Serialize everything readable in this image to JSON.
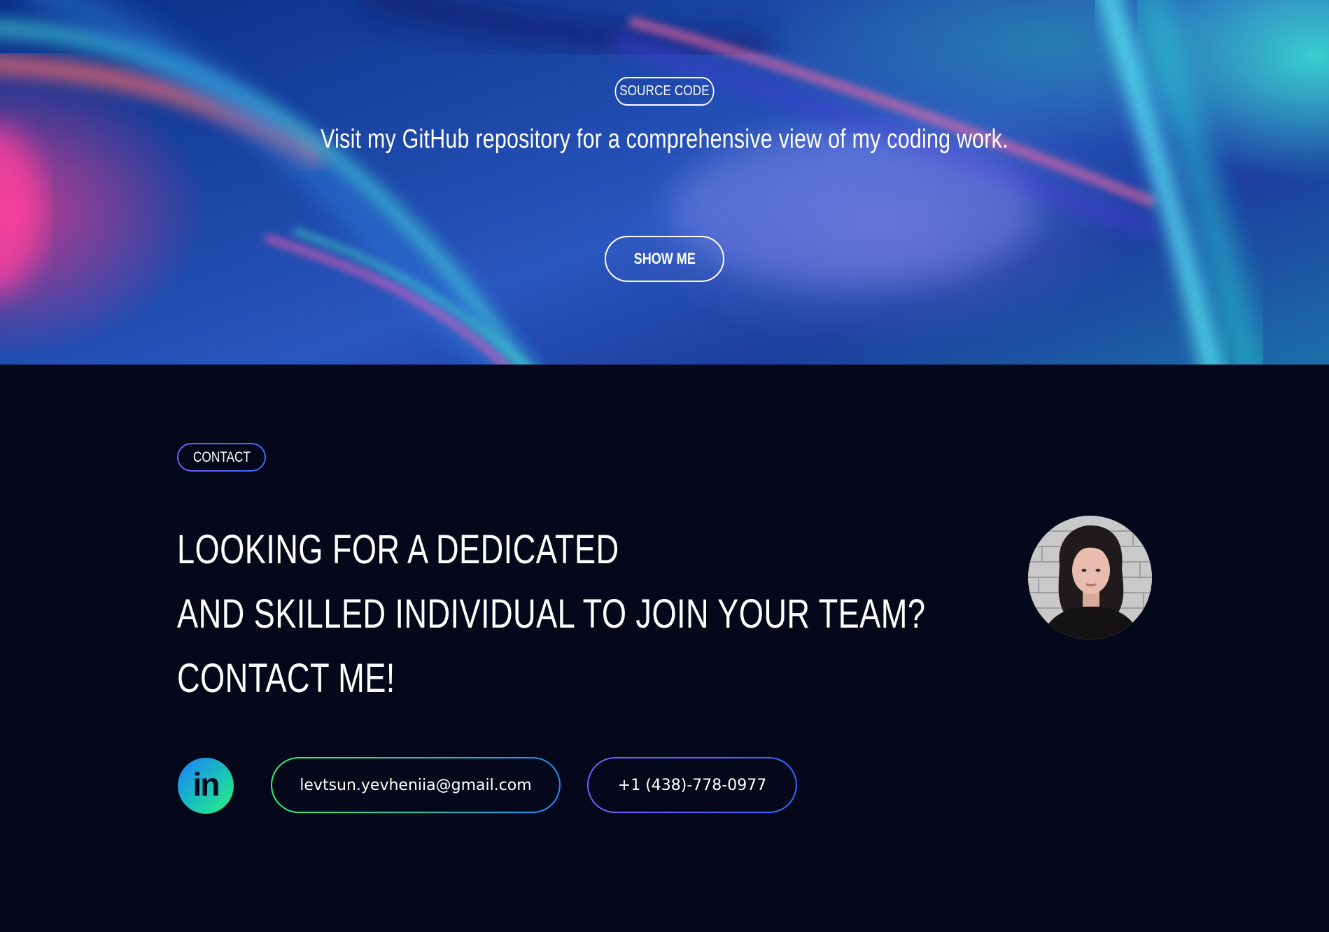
{
  "hero": {
    "badge": "SOURCE CODE",
    "description": "Visit my GitHub repository for a comprehensive view of my coding work.",
    "button_label": "SHOW ME"
  },
  "contact": {
    "badge": "CONTACT",
    "headline": [
      "LOOKING FOR A DEDICATED",
      "AND SKILLED INDIVIDUAL TO JOIN YOUR TEAM?",
      "CONTACT ME!"
    ],
    "linkedin_label": "in",
    "email": "levtsun.yevheniia@gmail.com",
    "phone": "+1 (438)-778-0977"
  },
  "colors": {
    "page_background": "#05081a",
    "accent_green": "#2df27a",
    "accent_blue": "#1e8cff",
    "accent_purple": "#7a5cff"
  },
  "icons": {
    "linkedin": "linkedin-icon",
    "avatar": "profile-photo"
  }
}
